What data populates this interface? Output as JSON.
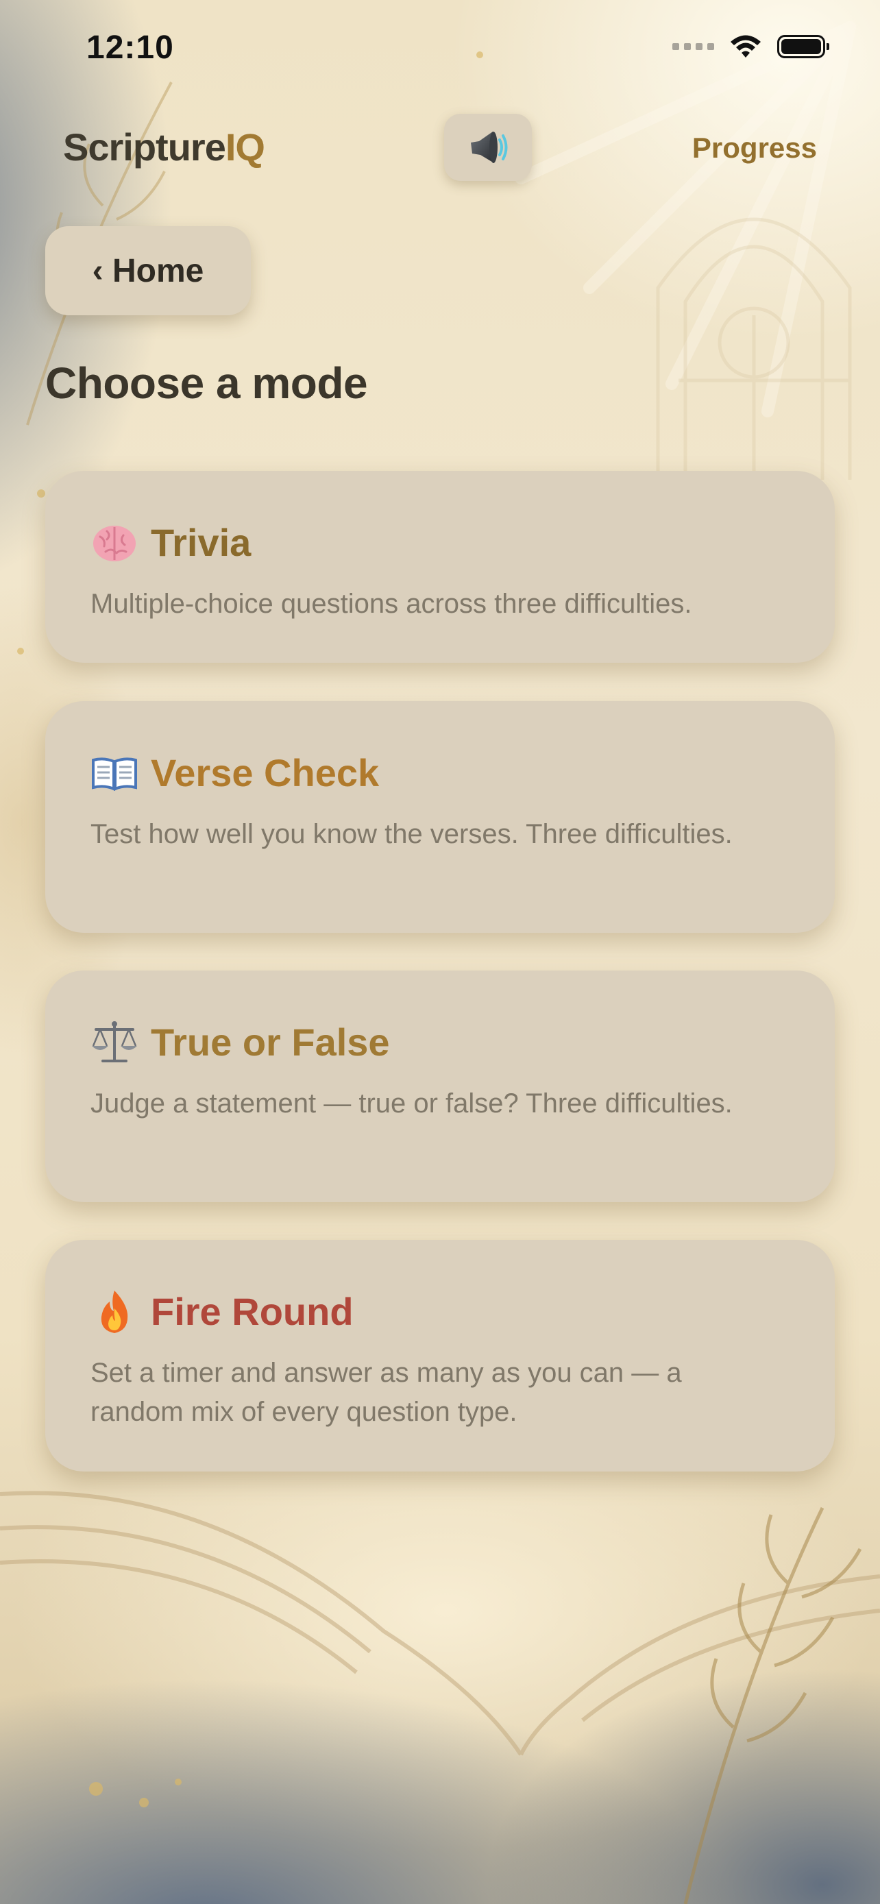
{
  "status_bar": {
    "time": "12:10"
  },
  "header": {
    "brand_part1": "Scripture",
    "brand_part2": "IQ",
    "sound_icon": "speaker-icon",
    "progress_label": "Progress"
  },
  "nav": {
    "home_label": "‹ Home"
  },
  "main": {
    "title": "Choose a mode",
    "modes": [
      {
        "icon": "brain-icon",
        "title": "Trivia",
        "description": "Multiple-choice questions across three difficulties.",
        "color": "#8a6a2c"
      },
      {
        "icon": "open-book-icon",
        "title": "Verse Check",
        "description": "Test how well you know the verses. Three difficulties.",
        "color": "#b07a2c"
      },
      {
        "icon": "scales-icon",
        "title": "True or False",
        "description": "Judge a statement — true or false? Three difficulties.",
        "color": "#a07a34"
      },
      {
        "icon": "fire-icon",
        "title": "Fire Round",
        "description": "Set a timer and answer as many as you can — a random mix of every question type.",
        "color": "#b0473a"
      }
    ]
  },
  "colors": {
    "brand_dark": "#3f3a2e",
    "brand_gold": "#a27a32",
    "card_bg": "#dbd0bd"
  }
}
